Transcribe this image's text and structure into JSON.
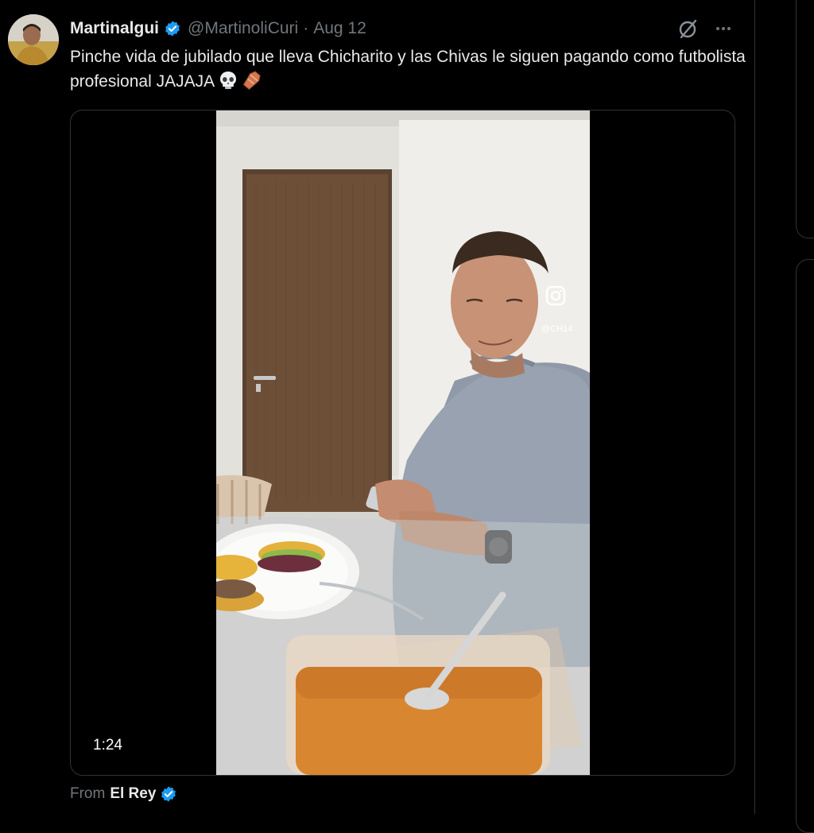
{
  "tweet": {
    "author_name": "Martinalgui",
    "handle": "@MartinoliCuri",
    "separator": "·",
    "date": "Aug 12",
    "text": "Pinche vida de jubilado que lleva Chicharito y las Chivas le siguen pagando como futbolista profesional JAJAJA",
    "emojis": [
      "skull-emoji",
      "coffin-emoji"
    ]
  },
  "media": {
    "duration": "1:24",
    "watermark": "@CH14"
  },
  "attribution": {
    "prefix": "From",
    "source_name": "El Rey"
  },
  "colors": {
    "background": "#000000",
    "text_primary": "#e7e9ea",
    "text_secondary": "#71767b",
    "verified_badge": "#1d9bf0",
    "border": "#2f3336"
  },
  "icons": [
    "verified-badge-icon",
    "grok-icon",
    "more-options-icon"
  ]
}
